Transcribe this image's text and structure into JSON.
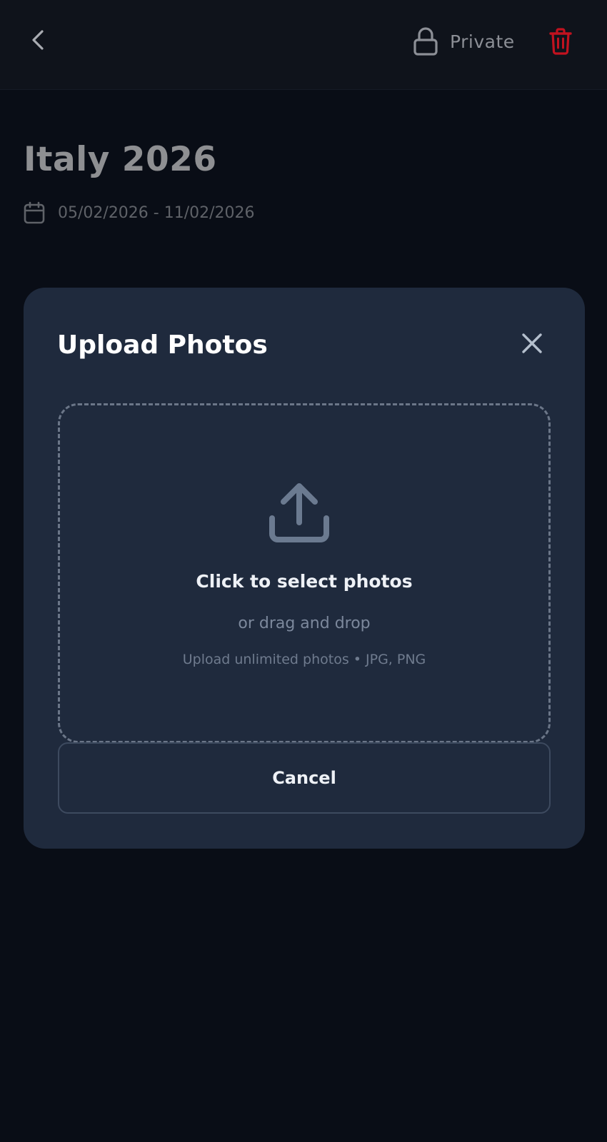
{
  "colors": {
    "background": "#090d16",
    "topbar": "#0f131b",
    "modal": "#1f2a3d",
    "delete_accent": "#c1121f",
    "icon_muted": "#6b7a90"
  },
  "topbar": {
    "back_icon": "chevron-left-icon",
    "privacy_icon": "lock-icon",
    "privacy_label": "Private",
    "delete_icon": "trash-icon"
  },
  "trip": {
    "title": "Italy 2026",
    "date_icon": "calendar-icon",
    "dates": "05/02/2026 - 11/02/2026"
  },
  "modal": {
    "title": "Upload Photos",
    "close_icon": "close-icon",
    "dropzone": {
      "icon": "upload-icon",
      "primary": "Click to select photos",
      "secondary": "or drag and drop",
      "hint": "Upload unlimited photos • JPG, PNG"
    },
    "cancel_label": "Cancel"
  }
}
